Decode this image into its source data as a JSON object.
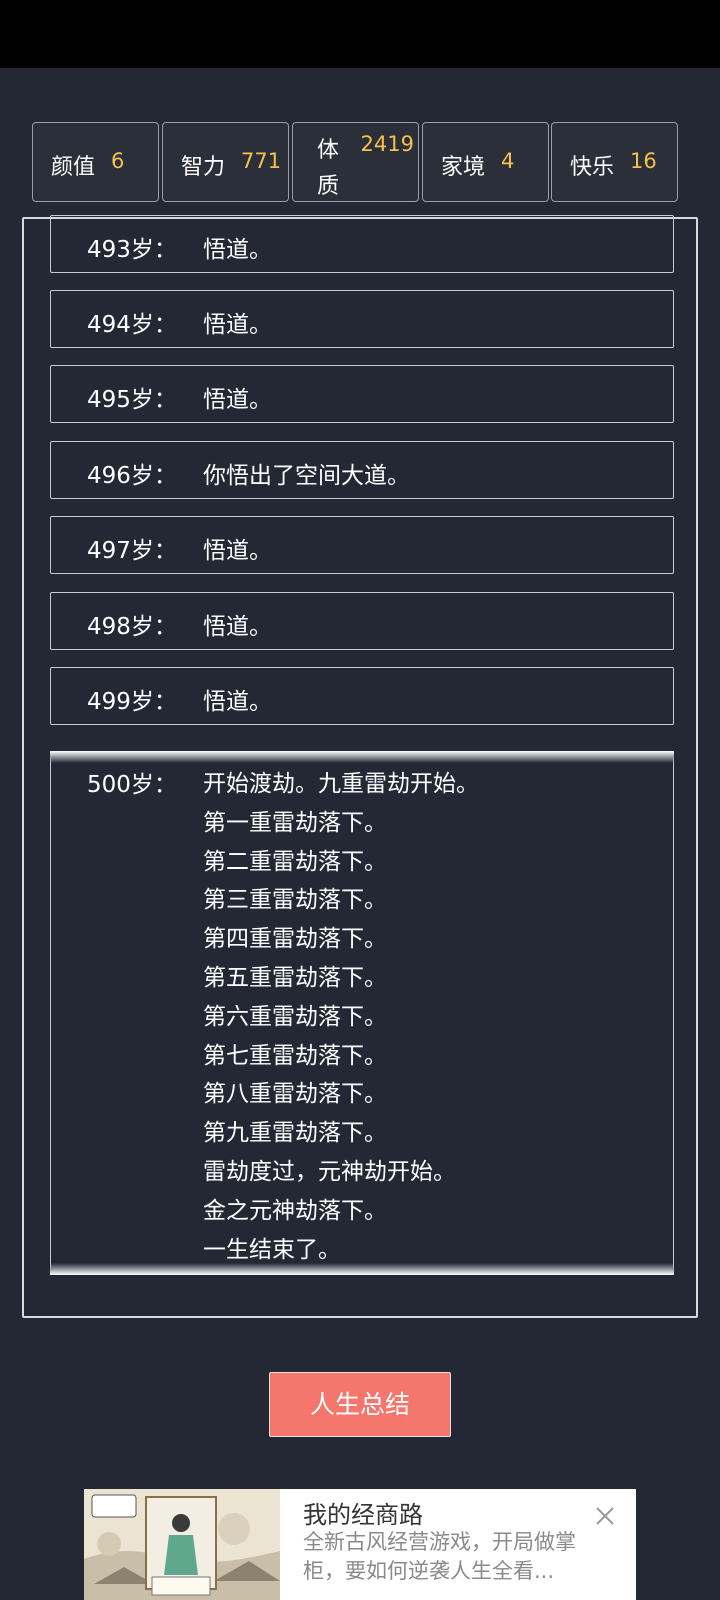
{
  "stats": [
    {
      "label": "颜值",
      "value": "6"
    },
    {
      "label": "智力",
      "value": "771"
    },
    {
      "label": "体质",
      "value": "2419"
    },
    {
      "label": "家境",
      "value": "4"
    },
    {
      "label": "快乐",
      "value": "16"
    }
  ],
  "log": {
    "entries": [
      {
        "age": "493岁：",
        "event": "悟道。"
      },
      {
        "age": "494岁：",
        "event": "悟道。"
      },
      {
        "age": "495岁：",
        "event": "悟道。"
      },
      {
        "age": "496岁：",
        "event": "你悟出了空间大道。"
      },
      {
        "age": "497岁：",
        "event": "悟道。"
      },
      {
        "age": "498岁：",
        "event": "悟道。"
      },
      {
        "age": "499岁：",
        "event": "悟道。"
      }
    ],
    "last": {
      "age": "500岁：",
      "lines": [
        "开始渡劫。九重雷劫开始。",
        "第一重雷劫落下。",
        "第二重雷劫落下。",
        "第三重雷劫落下。",
        "第四重雷劫落下。",
        "第五重雷劫落下。",
        "第六重雷劫落下。",
        "第七重雷劫落下。",
        "第八重雷劫落下。",
        "第九重雷劫落下。",
        "雷劫度过，元神劫开始。",
        "金之元神劫落下。",
        "一生结束了。"
      ]
    }
  },
  "summary_button": "人生总结",
  "ad": {
    "title": "我的经商路",
    "description": "全新古风经营游戏，开局做掌柜，要如何逆袭人生全看...",
    "close_icon": "close-icon"
  },
  "colors": {
    "background": "#232834",
    "stat_value": "#f5c04d",
    "button": "#f4766d"
  }
}
